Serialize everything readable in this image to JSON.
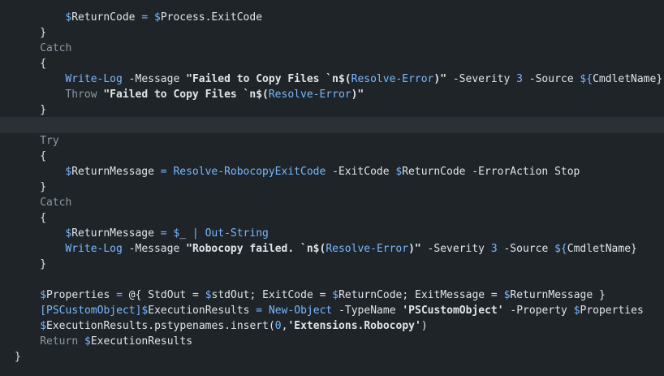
{
  "editor": {
    "lines": [
      {
        "indent": 8,
        "tokens": [
          {
            "t": "$",
            "c": "var-sigil"
          },
          {
            "t": "ReturnCode",
            "c": "var"
          },
          {
            "t": " = ",
            "c": "op"
          },
          {
            "t": "$",
            "c": "var-sigil"
          },
          {
            "t": "Process.ExitCode",
            "c": "var"
          }
        ]
      },
      {
        "indent": 4,
        "tokens": [
          {
            "t": "}",
            "c": "punct"
          }
        ]
      },
      {
        "indent": 4,
        "tokens": [
          {
            "t": "Catch",
            "c": "kw"
          }
        ]
      },
      {
        "indent": 4,
        "tokens": [
          {
            "t": "{",
            "c": "punct"
          }
        ]
      },
      {
        "indent": 8,
        "tokens": [
          {
            "t": "Write-Log",
            "c": "cmd"
          },
          {
            "t": " -Message ",
            "c": "param"
          },
          {
            "t": "\"Failed to Copy Files `n",
            "c": "str"
          },
          {
            "t": "$(",
            "c": "str"
          },
          {
            "t": "Resolve-Error",
            "c": "sub"
          },
          {
            "t": ")\"",
            "c": "str"
          },
          {
            "t": " -Severity ",
            "c": "param"
          },
          {
            "t": "3",
            "c": "num"
          },
          {
            "t": " -Source ",
            "c": "param"
          },
          {
            "t": "${",
            "c": "var-sigil"
          },
          {
            "t": "CmdletName",
            "c": "var"
          },
          {
            "t": "}",
            "c": "punct"
          }
        ]
      },
      {
        "indent": 8,
        "tokens": [
          {
            "t": "Throw",
            "c": "kw"
          },
          {
            "t": " ",
            "c": "plain"
          },
          {
            "t": "\"Failed to Copy Files `n",
            "c": "str"
          },
          {
            "t": "$(",
            "c": "str"
          },
          {
            "t": "Resolve-Error",
            "c": "sub"
          },
          {
            "t": ")\"",
            "c": "str"
          }
        ]
      },
      {
        "indent": 4,
        "tokens": [
          {
            "t": "}",
            "c": "punct"
          }
        ]
      },
      {
        "indent": 0,
        "current": true,
        "tokens": []
      },
      {
        "indent": 4,
        "tokens": [
          {
            "t": "Try",
            "c": "kw"
          }
        ]
      },
      {
        "indent": 4,
        "tokens": [
          {
            "t": "{",
            "c": "punct"
          }
        ]
      },
      {
        "indent": 8,
        "tokens": [
          {
            "t": "$",
            "c": "var-sigil"
          },
          {
            "t": "ReturnMessage",
            "c": "var"
          },
          {
            "t": " = ",
            "c": "op"
          },
          {
            "t": "Resolve-RobocopyExitCode",
            "c": "cmd"
          },
          {
            "t": " -ExitCode ",
            "c": "param"
          },
          {
            "t": "$",
            "c": "var-sigil"
          },
          {
            "t": "ReturnCode",
            "c": "var"
          },
          {
            "t": " -ErrorAction Stop",
            "c": "param"
          }
        ]
      },
      {
        "indent": 4,
        "tokens": [
          {
            "t": "}",
            "c": "punct"
          }
        ]
      },
      {
        "indent": 4,
        "tokens": [
          {
            "t": "Catch",
            "c": "kw"
          }
        ]
      },
      {
        "indent": 4,
        "tokens": [
          {
            "t": "{",
            "c": "punct"
          }
        ]
      },
      {
        "indent": 8,
        "tokens": [
          {
            "t": "$",
            "c": "var-sigil"
          },
          {
            "t": "ReturnMessage",
            "c": "var"
          },
          {
            "t": " = ",
            "c": "op"
          },
          {
            "t": "$",
            "c": "var-sigil"
          },
          {
            "t": "_",
            "c": "var"
          },
          {
            "t": " | ",
            "c": "op"
          },
          {
            "t": "Out-String",
            "c": "cmd"
          }
        ]
      },
      {
        "indent": 8,
        "tokens": [
          {
            "t": "Write-Log",
            "c": "cmd"
          },
          {
            "t": " -Message ",
            "c": "param"
          },
          {
            "t": "\"Robocopy failed. `n",
            "c": "str"
          },
          {
            "t": "$(",
            "c": "str"
          },
          {
            "t": "Resolve-Error",
            "c": "sub"
          },
          {
            "t": ")\"",
            "c": "str"
          },
          {
            "t": " -Severity ",
            "c": "param"
          },
          {
            "t": "3",
            "c": "num"
          },
          {
            "t": " -Source ",
            "c": "param"
          },
          {
            "t": "${",
            "c": "var-sigil"
          },
          {
            "t": "CmdletName",
            "c": "var"
          },
          {
            "t": "}",
            "c": "punct"
          }
        ]
      },
      {
        "indent": 4,
        "tokens": [
          {
            "t": "}",
            "c": "punct"
          }
        ]
      },
      {
        "indent": 0,
        "tokens": []
      },
      {
        "indent": 4,
        "tokens": [
          {
            "t": "$",
            "c": "var-sigil"
          },
          {
            "t": "Properties",
            "c": "var"
          },
          {
            "t": " = ",
            "c": "op"
          },
          {
            "t": "@{ StdOut = ",
            "c": "plain"
          },
          {
            "t": "$",
            "c": "var-sigil"
          },
          {
            "t": "stdOut",
            "c": "var"
          },
          {
            "t": "; ExitCode = ",
            "c": "plain"
          },
          {
            "t": "$",
            "c": "var-sigil"
          },
          {
            "t": "ReturnCode",
            "c": "var"
          },
          {
            "t": "; ExitMessage = ",
            "c": "plain"
          },
          {
            "t": "$",
            "c": "var-sigil"
          },
          {
            "t": "ReturnMessage",
            "c": "var"
          },
          {
            "t": " }",
            "c": "plain"
          }
        ]
      },
      {
        "indent": 4,
        "tokens": [
          {
            "t": "[PSCustomObject]",
            "c": "type"
          },
          {
            "t": "$",
            "c": "var-sigil"
          },
          {
            "t": "ExecutionResults",
            "c": "var"
          },
          {
            "t": " = ",
            "c": "op"
          },
          {
            "t": "New-Object",
            "c": "cmd"
          },
          {
            "t": " -TypeName ",
            "c": "param"
          },
          {
            "t": "'PSCustomObject'",
            "c": "str"
          },
          {
            "t": " -Property ",
            "c": "param"
          },
          {
            "t": "$",
            "c": "var-sigil"
          },
          {
            "t": "Properties",
            "c": "var"
          }
        ]
      },
      {
        "indent": 4,
        "tokens": [
          {
            "t": "$",
            "c": "var-sigil"
          },
          {
            "t": "ExecutionResults.pstypenames.insert",
            "c": "var"
          },
          {
            "t": "(",
            "c": "punct"
          },
          {
            "t": "0",
            "c": "num"
          },
          {
            "t": ",",
            "c": "punct"
          },
          {
            "t": "'Extensions.Robocopy'",
            "c": "str"
          },
          {
            "t": ")",
            "c": "punct"
          }
        ]
      },
      {
        "indent": 4,
        "tokens": [
          {
            "t": "Return",
            "c": "kw"
          },
          {
            "t": " ",
            "c": "plain"
          },
          {
            "t": "$",
            "c": "var-sigil"
          },
          {
            "t": "ExecutionResults",
            "c": "var"
          }
        ]
      },
      {
        "indent": 0,
        "tokens": [
          {
            "t": "}",
            "c": "punct"
          }
        ]
      }
    ]
  }
}
